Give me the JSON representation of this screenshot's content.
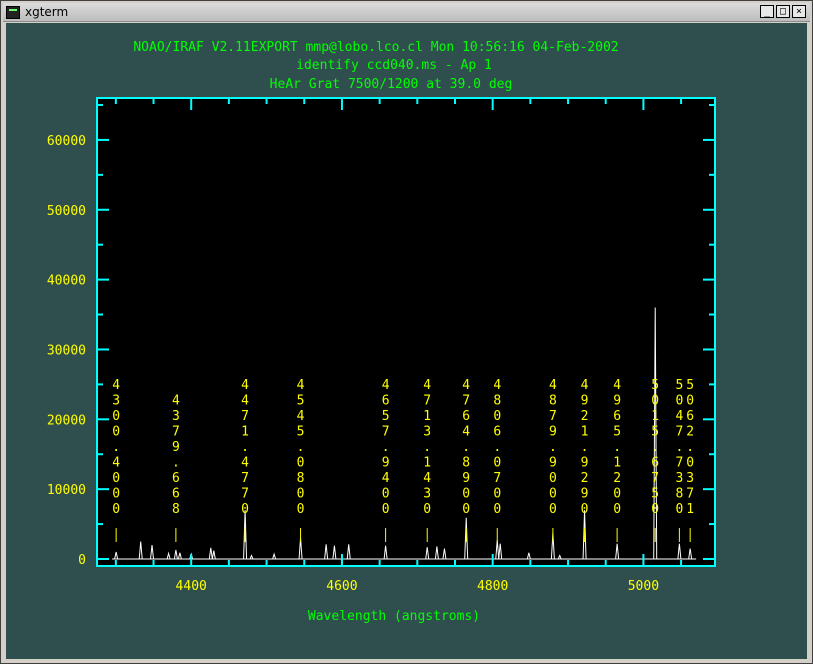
{
  "window": {
    "title": "xgterm",
    "buttons": {
      "minimize": "_",
      "maximize": "□",
      "close": "×"
    }
  },
  "colors": {
    "terminal_bg": "#2f4f4f",
    "plot_bg": "#000000",
    "frame": "#00ffff",
    "header_text": "#00ff00",
    "axis_label_text": "#00ff00",
    "tick_label_text": "#ffff00",
    "line_labels": "#ffff00",
    "spectrum": "#ffffff"
  },
  "header": {
    "line1": "NOAO/IRAF V2.11EXPORT mmp@lobo.lco.cl Mon 10:56:16 04-Feb-2002",
    "line2": "identify ccd040.ms - Ap 1",
    "line3": "HeAr Grat 7500/1200 at 39.0 deg"
  },
  "chart_data": {
    "type": "line",
    "title": "",
    "xlabel": "Wavelength (angstroms)",
    "ylabel": "",
    "xlim": [
      4275,
      5095
    ],
    "ylim": [
      -1000,
      66000
    ],
    "x_ticks": [
      4400,
      4600,
      4800,
      5000
    ],
    "x_tick_labels": [
      "4400",
      "4600",
      "4800",
      "5000"
    ],
    "y_ticks": [
      0,
      10000,
      20000,
      30000,
      40000,
      50000,
      60000
    ],
    "y_tick_labels": [
      "0",
      "10000",
      "20000",
      "30000",
      "40000",
      "50000",
      "60000"
    ],
    "grid": false,
    "spectrum_lines": [
      {
        "x": 4300.4,
        "y": 1000
      },
      {
        "x": 4333,
        "y": 2500
      },
      {
        "x": 4348,
        "y": 2000
      },
      {
        "x": 4370,
        "y": 800
      },
      {
        "x": 4379.67,
        "y": 1300
      },
      {
        "x": 4385,
        "y": 900
      },
      {
        "x": 4400,
        "y": 700
      },
      {
        "x": 4426,
        "y": 1600
      },
      {
        "x": 4430,
        "y": 1200
      },
      {
        "x": 4471.48,
        "y": 7000
      },
      {
        "x": 4480,
        "y": 500
      },
      {
        "x": 4510,
        "y": 700
      },
      {
        "x": 4545.08,
        "y": 3000
      },
      {
        "x": 4579,
        "y": 2100
      },
      {
        "x": 4590,
        "y": 1900
      },
      {
        "x": 4609,
        "y": 2100
      },
      {
        "x": 4657.94,
        "y": 1900
      },
      {
        "x": 4713.14,
        "y": 1700
      },
      {
        "x": 4726,
        "y": 1800
      },
      {
        "x": 4736,
        "y": 1500
      },
      {
        "x": 4764.89,
        "y": 5900
      },
      {
        "x": 4806.07,
        "y": 2700
      },
      {
        "x": 4810,
        "y": 2200
      },
      {
        "x": 4848,
        "y": 900
      },
      {
        "x": 4879.9,
        "y": 3700
      },
      {
        "x": 4889,
        "y": 500
      },
      {
        "x": 4921.93,
        "y": 7000
      },
      {
        "x": 4965.12,
        "y": 2200
      },
      {
        "x": 5015.675,
        "y": 36000
      },
      {
        "x": 5047.738,
        "y": 2200
      },
      {
        "x": 5062.037,
        "y": 1500
      }
    ],
    "line_ids": [
      {
        "x": 4300.4,
        "label": "4300.4000"
      },
      {
        "x": 4379.668,
        "label": "4379.668"
      },
      {
        "x": 4471.477,
        "label": "4471.4770"
      },
      {
        "x": 4545.08,
        "label": "4545.0800"
      },
      {
        "x": 4657.94,
        "label": "4657.9400"
      },
      {
        "x": 4713.143,
        "label": "4713.1430"
      },
      {
        "x": 4764.89,
        "label": "4764.8900"
      },
      {
        "x": 4806.07,
        "label": "4806.0700"
      },
      {
        "x": 4879.9,
        "label": "4879.9000"
      },
      {
        "x": 4921.929,
        "label": "4921.9290"
      },
      {
        "x": 4965.12,
        "label": "4965.1200"
      },
      {
        "x": 5015.675,
        "label": "5015.6750"
      },
      {
        "x": 5047.738,
        "label": "5047.7380"
      },
      {
        "x": 5062.037,
        "label": "5062.0371"
      }
    ]
  }
}
